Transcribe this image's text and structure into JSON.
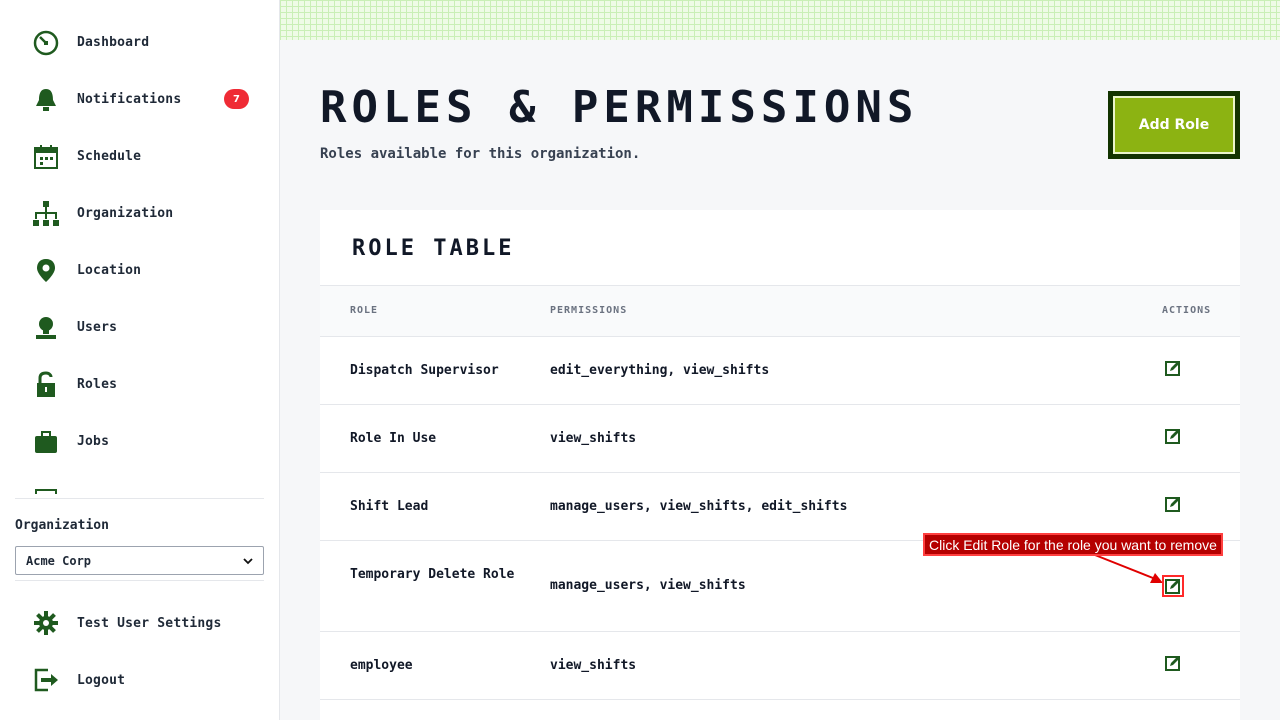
{
  "sidebar": {
    "items": [
      {
        "label": "Dashboard",
        "icon": "dashboard-gauge-icon"
      },
      {
        "label": "Notifications",
        "icon": "bell-icon",
        "badge": "7"
      },
      {
        "label": "Schedule",
        "icon": "calendar-icon"
      },
      {
        "label": "Organization",
        "icon": "org-chart-icon"
      },
      {
        "label": "Location",
        "icon": "map-pin-icon"
      },
      {
        "label": "Users",
        "icon": "user-icon"
      },
      {
        "label": "Roles",
        "icon": "unlock-icon"
      },
      {
        "label": "Jobs",
        "icon": "briefcase-icon"
      }
    ],
    "org_label": "Organization",
    "org_selected": "Acme Corp",
    "settings_label": "Test User Settings",
    "logout_label": "Logout"
  },
  "header": {
    "title": "ROLES & PERMISSIONS",
    "subtitle": "Roles available for this organization.",
    "add_button": "Add Role"
  },
  "table": {
    "title": "ROLE TABLE",
    "columns": [
      "ROLE",
      "PERMISSIONS",
      "ACTIONS"
    ],
    "rows": [
      {
        "role": "Dispatch Supervisor",
        "permissions": "edit_everything, view_shifts"
      },
      {
        "role": "Role In Use",
        "permissions": "view_shifts"
      },
      {
        "role": "Shift Lead",
        "permissions": "manage_users, view_shifts, edit_shifts"
      },
      {
        "role": "Temporary Delete Role",
        "permissions": "manage_users, view_shifts"
      },
      {
        "role": "employee",
        "permissions": "view_shifts"
      }
    ]
  },
  "annotation": {
    "text": "Click Edit Role for the role you want to remove"
  },
  "colors": {
    "accent": "#8cb312",
    "icon": "#1f5a1f",
    "badge": "#ef2b35",
    "annotation": "#b50000"
  }
}
